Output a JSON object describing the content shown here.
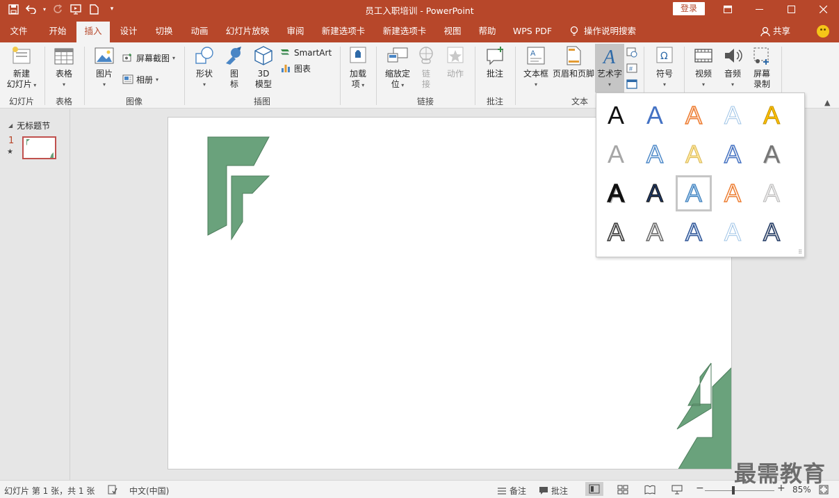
{
  "window": {
    "title": "员工入职培训  -  PowerPoint",
    "login": "登录",
    "controls": [
      "ribbon-display-icon",
      "minimize-icon",
      "maximize-icon",
      "close-icon"
    ]
  },
  "tabs": [
    "文件",
    "开始",
    "插入",
    "设计",
    "切换",
    "动画",
    "幻灯片放映",
    "审阅",
    "新建选项卡",
    "新建选项卡",
    "视图",
    "帮助",
    "WPS PDF"
  ],
  "active_tab": "插入",
  "tell_me": "操作说明搜索",
  "share": "共享",
  "ribbon": {
    "groups": {
      "slides": "幻灯片",
      "tables": "表格",
      "images": "图像",
      "illustrations": "插图",
      "addins": "",
      "links": "链接",
      "comments": "批注",
      "text": "文本"
    },
    "buttons": {
      "new_slide_1": "新建",
      "new_slide_2": "幻灯片",
      "table": "表格",
      "picture": "图片",
      "screenshot": "屏幕截图",
      "album": "相册",
      "shapes": "形状",
      "icons_1": "图",
      "icons_2": "标",
      "model_1": "3D",
      "model_2": "模型",
      "smartart": "SmartArt",
      "chart": "图表",
      "addin_1": "加载",
      "addin_2": "项",
      "zoom_1": "缩放定",
      "zoom_2": "位",
      "link_1": "链",
      "link_2": "接",
      "action": "动作",
      "comment": "批注",
      "textbox": "文本框",
      "header_footer": "页眉和页脚",
      "wordart": "艺术字",
      "symbol": "符号",
      "video": "视频",
      "audio": "音频",
      "record_1": "屏幕",
      "record_2": "录制"
    }
  },
  "thumbnails": {
    "section": "无标题节",
    "slide_number": "1"
  },
  "gallery": {
    "letter": "A",
    "selected_index": 12
  },
  "status": {
    "slide_info": "幻灯片 第 1 张，共 1 张",
    "language": "中文(中国)",
    "notes": "备注",
    "comments": "批注",
    "zoom": "85%"
  },
  "watermark": "最需教育",
  "colors": {
    "accent": "#b7472a",
    "shape_green": "#6aa27c",
    "shape_stroke": "#4e7d5c"
  }
}
